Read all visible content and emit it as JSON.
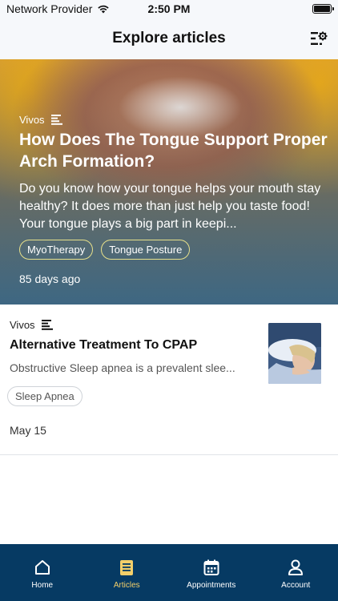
{
  "status_bar": {
    "carrier": "Network Provider",
    "time": "2:50 PM",
    "icons": [
      "wifi-icon",
      "battery-icon"
    ]
  },
  "nav": {
    "title": "Explore articles",
    "filter_icon": "filter-settings-icon"
  },
  "featured_article": {
    "source": "Vivos",
    "title": "How Does The Tongue Support Proper Arch Formation?",
    "description": "Do you know how your tongue helps your mouth stay healthy? It does more than just help you taste food! Your tongue plays a big part in keepi...",
    "tags": [
      "MyoTherapy",
      "Tongue Posture"
    ],
    "date": "85 days ago"
  },
  "articles": [
    {
      "source": "Vivos",
      "title": "Alternative Treatment To CPAP",
      "description": "Obstructive Sleep apnea is a prevalent slee...",
      "tags": [
        "Sleep Apnea"
      ],
      "date": "May 15"
    }
  ],
  "tab_bar": {
    "active": "Articles",
    "active_color": "#f3cf6a",
    "background_color": "#063a63",
    "tabs": [
      {
        "label": "Home",
        "icon": "home-icon"
      },
      {
        "label": "Articles",
        "icon": "articles-icon"
      },
      {
        "label": "Appointments",
        "icon": "calendar-icon"
      },
      {
        "label": "Account",
        "icon": "user-icon"
      }
    ]
  }
}
